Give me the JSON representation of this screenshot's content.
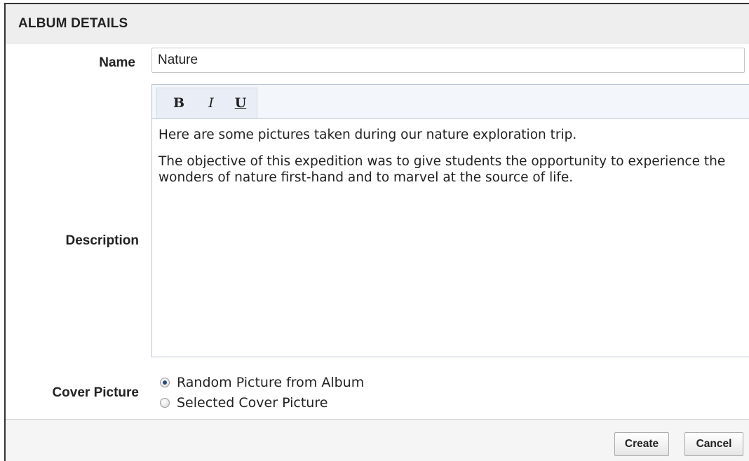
{
  "header": {
    "title": "ALBUM DETAILS"
  },
  "form": {
    "name_label": "Name",
    "name_value": "Nature",
    "description_label": "Description",
    "description_paragraphs": [
      "Here are some pictures taken during our nature exploration trip.",
      "The objective of this expedition was to give students the opportunity to experience the wonders of nature first-hand and to marvel at the source of life."
    ],
    "toolbar": {
      "bold": "B",
      "italic": "I",
      "underline": "U"
    },
    "cover_label": "Cover Picture",
    "cover_options": [
      {
        "label": "Random Picture from Album",
        "checked": true
      },
      {
        "label": "Selected Cover Picture",
        "checked": false
      }
    ]
  },
  "footer": {
    "create_label": "Create",
    "cancel_label": "Cancel"
  }
}
